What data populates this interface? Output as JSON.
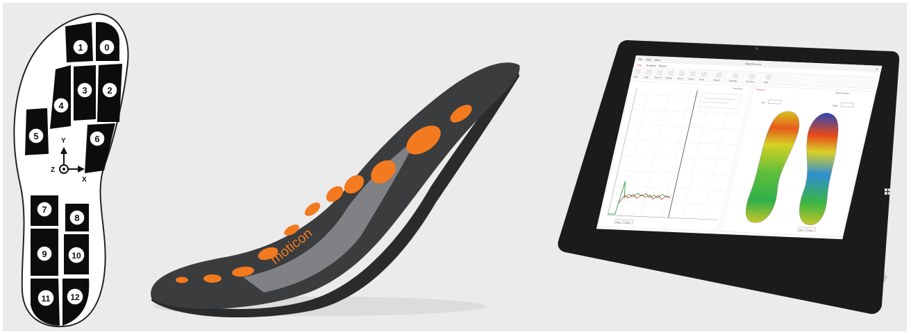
{
  "sensor_map": {
    "sensors": [
      "0",
      "1",
      "2",
      "3",
      "4",
      "5",
      "6",
      "7",
      "8",
      "9",
      "10",
      "11",
      "12"
    ],
    "axis_labels": {
      "y": "Y",
      "x": "X",
      "z": "Z"
    }
  },
  "insole": {
    "brand_text": "moticon",
    "colors": {
      "base": "#3a3c3e",
      "accent": "#f47a20",
      "arch": "#8c8d90"
    }
  },
  "tablet": {
    "app": {
      "menu": [
        "File",
        "Edit",
        "View"
      ],
      "title": "OpenGo Live",
      "tabs": [
        "Live",
        "Analyze",
        "Report"
      ],
      "toolbar": [
        "Start",
        "Stop",
        "Record",
        "Marker",
        "Zoom",
        "Reset",
        "Sync",
        "Export",
        "Settings",
        "Devices",
        "Help"
      ],
      "graph_panel_title": "Total force",
      "map_panel_title": "Pressure",
      "legend_left": "Left",
      "legend_right": "Right",
      "select_sensor": "Select Sensor",
      "start_button": "Start",
      "stop_button": "Stop"
    },
    "colors": {
      "bezel": "#1b1b1c",
      "stand": "#c9cacc",
      "plot_green": "#2e9b3f",
      "plot_red": "#c8383a"
    }
  }
}
